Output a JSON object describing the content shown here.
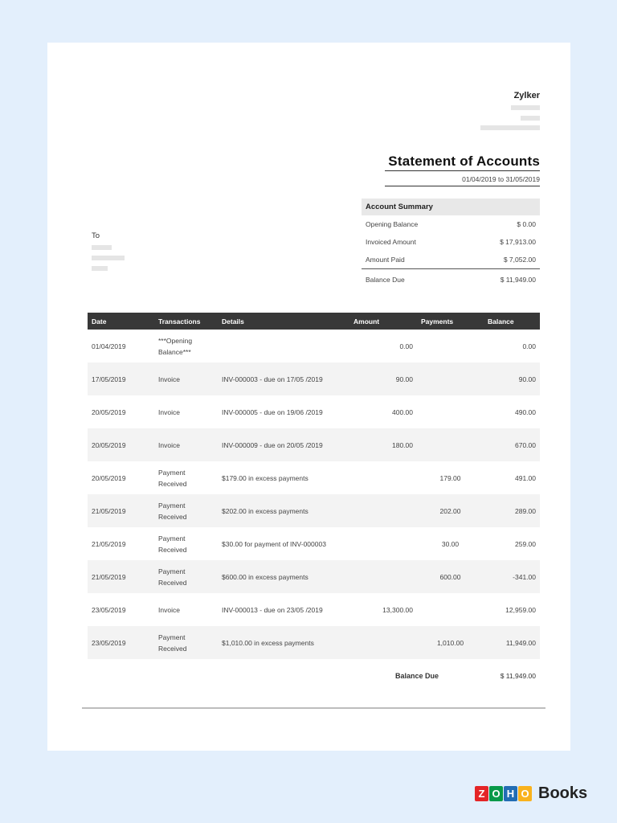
{
  "company": {
    "name": "Zylker"
  },
  "statement": {
    "title": "Statement of Accounts",
    "period": "01/04/2019 to 31/05/2019"
  },
  "summary": {
    "header": "Account Summary",
    "rows": [
      {
        "label": "Opening Balance",
        "value": "$ 0.00"
      },
      {
        "label": "Invoiced Amount",
        "value": "$ 17,913.00"
      },
      {
        "label": "Amount Paid",
        "value": "$ 7,052.00"
      }
    ],
    "total": {
      "label": "Balance Due",
      "value": "$ 11,949.00"
    }
  },
  "recipient": {
    "to_label": "To"
  },
  "table": {
    "headers": {
      "date": "Date",
      "transactions": "Transactions",
      "details": "Details",
      "amount": "Amount",
      "payments": "Payments",
      "balance": "Balance"
    },
    "rows": [
      {
        "date": "01/04/2019",
        "type": "***Opening Balance***",
        "details": "",
        "amount": "0.00",
        "payment": "",
        "balance": "0.00"
      },
      {
        "date": "17/05/2019",
        "type": "Invoice",
        "details": "INV-000003 - due on 17/05 /2019",
        "amount": "90.00",
        "payment": "",
        "balance": "90.00"
      },
      {
        "date": "20/05/2019",
        "type": "Invoice",
        "details": "INV-000005 - due on 19/06 /2019",
        "amount": "400.00",
        "payment": "",
        "balance": "490.00"
      },
      {
        "date": "20/05/2019",
        "type": "Invoice",
        "details": "INV-000009 - due on 20/05 /2019",
        "amount": "180.00",
        "payment": "",
        "balance": "670.00"
      },
      {
        "date": "20/05/2019",
        "type": "Payment Received",
        "details": "$179.00 in excess payments",
        "amount": "",
        "payment": "179.00",
        "balance": "491.00"
      },
      {
        "date": "21/05/2019",
        "type": "Payment Received",
        "details": "$202.00 in excess payments",
        "amount": "",
        "payment": "202.00",
        "balance": "289.00"
      },
      {
        "date": "21/05/2019",
        "type": "Payment Received",
        "details": "$30.00 for payment of INV-000003",
        "amount": "",
        "payment": "30.00",
        "balance": "259.00"
      },
      {
        "date": "21/05/2019",
        "type": "Payment Received",
        "details": "$600.00 in excess payments",
        "amount": "",
        "payment": "600.00",
        "balance": "-341.00"
      },
      {
        "date": "23/05/2019",
        "type": "Invoice",
        "details": "INV-000013 - due on 23/05 /2019",
        "amount": "13,300.00",
        "payment": "",
        "balance": "12,959.00"
      },
      {
        "date": "23/05/2019",
        "type": "Payment Received",
        "details": "$1,010.00 in excess payments",
        "amount": "",
        "payment": "1,010.00",
        "balance": "11,949.00"
      }
    ]
  },
  "footer": {
    "balance_due_label": "Balance Due",
    "balance_due_value": "$ 11,949.00"
  },
  "brand": {
    "letters": [
      "Z",
      "O",
      "H",
      "O"
    ],
    "letter_colors": [
      "#e42527",
      "#089949",
      "#226db4",
      "#f9b21d"
    ],
    "product": "Books"
  }
}
